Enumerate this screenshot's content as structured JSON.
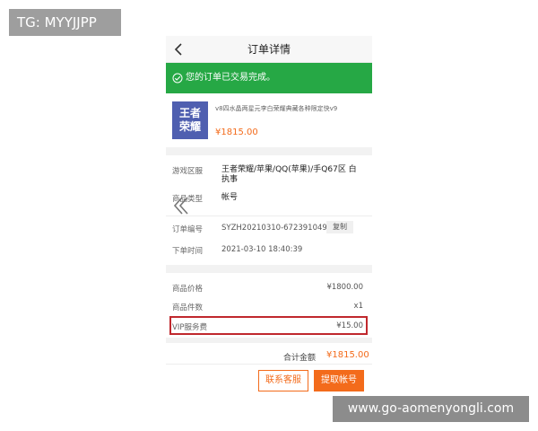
{
  "tg_badge": "TG: MYYJJPP",
  "nav": {
    "title": "订单详情"
  },
  "status": {
    "message": "您的订单已交易完成。"
  },
  "product": {
    "thumb_line1": "王者",
    "thumb_line2": "荣耀",
    "title": "v8四水晶两星元李白荣耀典藏各种限定快v9",
    "price": "¥1815.00"
  },
  "details": {
    "region_label": "游戏区服",
    "region_value_line1": "王者荣耀/苹果/QQ(苹果)/手Q67区 白",
    "region_value_line2": "执事",
    "type_label": "商品类型",
    "type_value": "帐号",
    "order_no_label": "订单编号",
    "order_no_value": "SYZH20210310-672391049",
    "copy_label": "复制",
    "time_label": "下单时间",
    "time_value": "2021-03-10 18:40:39"
  },
  "fees": {
    "price_label": "商品价格",
    "price_value": "¥1800.00",
    "qty_label": "商品件数",
    "qty_value": "x1",
    "vip_label": "VIP服务费",
    "vip_value": "¥15.00",
    "total_label": "合计金额",
    "total_value": "¥1815.00"
  },
  "actions": {
    "contact_label": "联系客服",
    "extract_label": "提取帐号"
  },
  "watermark": "www.go-aomenyongli.com",
  "colors": {
    "success_green": "#26a845",
    "accent_orange": "#f36b1b",
    "highlight_red": "#c0282d",
    "thumb_blue": "#4f5fb0"
  }
}
